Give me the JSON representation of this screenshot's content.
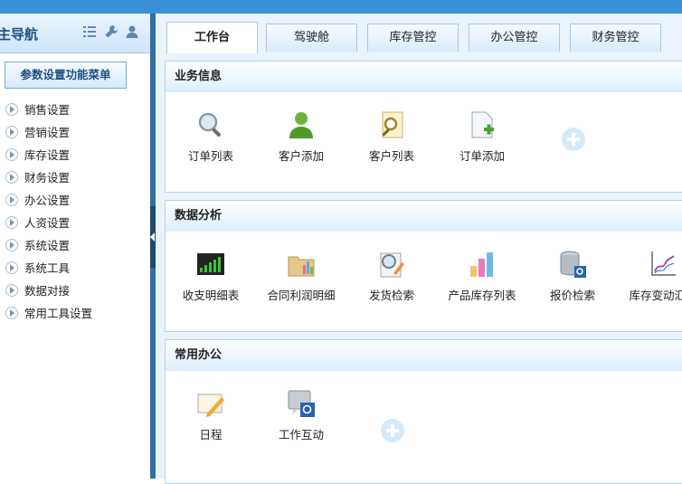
{
  "sidebar": {
    "title": "导航",
    "title_prefix": "主",
    "menu_button": "参数设置功能菜单",
    "items": [
      {
        "label": "销售设置"
      },
      {
        "label": "营销设置"
      },
      {
        "label": "库存设置"
      },
      {
        "label": "财务设置"
      },
      {
        "label": "办公设置"
      },
      {
        "label": "人资设置"
      },
      {
        "label": "系统设置"
      },
      {
        "label": "系统工具"
      },
      {
        "label": "数据对接"
      },
      {
        "label": "常用工具设置"
      }
    ],
    "header_icons": [
      "list-icon",
      "wrench-icon",
      "user-icon"
    ]
  },
  "tabs": [
    {
      "label": "工作台",
      "active": true
    },
    {
      "label": "驾驶舱"
    },
    {
      "label": "库存管控"
    },
    {
      "label": "办公管控"
    },
    {
      "label": "财务管控"
    }
  ],
  "sections": [
    {
      "title": "业务信息",
      "tiles": [
        {
          "label": "订单列表",
          "icon": "magnifier-icon"
        },
        {
          "label": "客户添加",
          "icon": "person-icon"
        },
        {
          "label": "客户列表",
          "icon": "document-search-icon"
        },
        {
          "label": "订单添加",
          "icon": "document-add-icon"
        }
      ]
    },
    {
      "title": "数据分析",
      "tiles": [
        {
          "label": "收支明细表",
          "icon": "bar-signal-icon"
        },
        {
          "label": "合同利润明细",
          "icon": "folder-chart-icon"
        },
        {
          "label": "发货检索",
          "icon": "search-edit-icon"
        },
        {
          "label": "产品库存列表",
          "icon": "bar-chart-icon"
        },
        {
          "label": "报价检索",
          "icon": "database-search-icon"
        },
        {
          "label": "库存变动汇总",
          "icon": "line-chart-icon"
        }
      ]
    },
    {
      "title": "常用办公",
      "tiles": [
        {
          "label": "日程",
          "icon": "notepad-pen-icon"
        },
        {
          "label": "工作互动",
          "icon": "chat-search-icon"
        }
      ]
    }
  ],
  "colors": {
    "accent": "#3a8fd6",
    "splitter": "#2e6fa8",
    "main_bg": "#eaf3fb"
  }
}
